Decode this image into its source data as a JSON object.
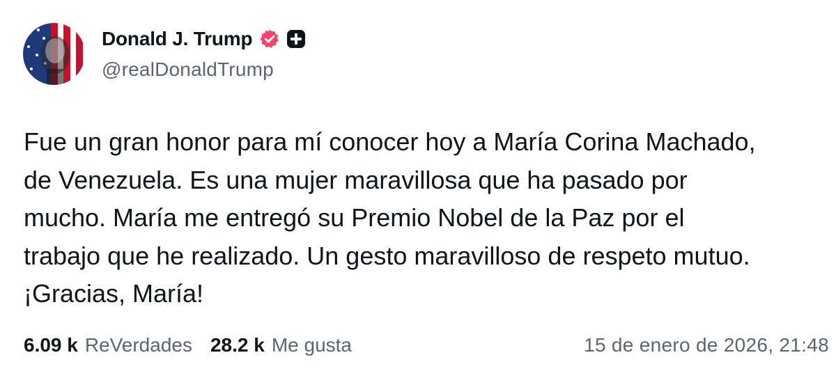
{
  "author": {
    "display_name": "Donald J. Trump",
    "handle": "@realDonaldTrump",
    "avatar_icon": "flag-portrait-avatar",
    "verified_icon": "verified-badge-icon",
    "verified_color": "#f5456b",
    "extra_badge_icon": "plus-badge-icon"
  },
  "post": {
    "lines": [
      "Fue un gran honor para mí conocer hoy a María Corina Machado,",
      "de Venezuela. Es una mujer maravillosa que ha pasado por",
      "mucho. María me entregó su Premio Nobel de la Paz por el",
      "trabajo que he realizado. Un gesto maravilloso de respeto mutuo.",
      "¡Gracias, María!"
    ]
  },
  "stats": {
    "reposts_count": "6.09 k",
    "reposts_label": "ReVerdades",
    "likes_count": "28.2 k",
    "likes_label": "Me gusta"
  },
  "timestamp": "15 de enero de 2026, 21:48"
}
